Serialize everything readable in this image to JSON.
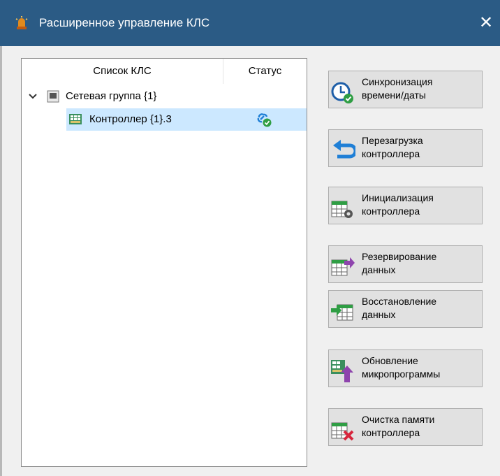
{
  "window": {
    "title": "Расширенное управление КЛС",
    "close_glyph": "✕",
    "app_icon": "warning-light-icon"
  },
  "tree": {
    "columns": {
      "name": "Список КЛС",
      "status": "Статус"
    },
    "group": {
      "label": "Сетевая группа {1}",
      "expanded": true,
      "icon": "network-group-icon"
    },
    "controller": {
      "label": "Контроллер {1}.3",
      "selected": true,
      "icon": "controller-icon",
      "status_icon": "link-ok-icon"
    }
  },
  "buttons": [
    {
      "label": "Синхронизация\nвремени/даты",
      "icon": "clock-check-icon"
    },
    {
      "label": "Перезагрузка\nконтроллера",
      "icon": "undo-arrow-icon"
    },
    {
      "label": "Инициализация\nконтроллера",
      "icon": "table-gear-icon"
    },
    {
      "label": "Резервирование\nданных",
      "icon": "table-export-icon"
    },
    {
      "label": "Восстановление\nданных",
      "icon": "table-import-icon"
    },
    {
      "label": "Обновление\nмикропрограммы",
      "icon": "firmware-upload-icon"
    },
    {
      "label": "Очистка памяти\nконтроллера",
      "icon": "table-delete-icon"
    }
  ],
  "colors": {
    "titlebar": "#2b5b85",
    "selection": "#cce8ff",
    "accent_blue": "#1f7fd6",
    "accent_green": "#2f9e44"
  }
}
